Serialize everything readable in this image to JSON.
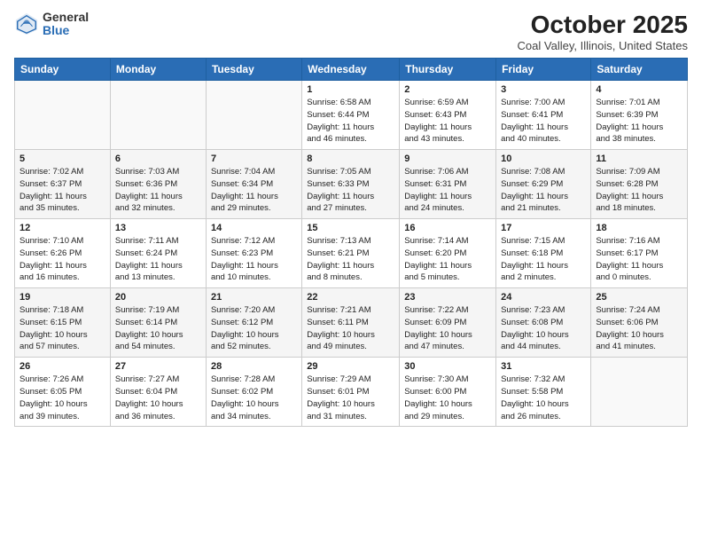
{
  "logo": {
    "general": "General",
    "blue": "Blue"
  },
  "title": "October 2025",
  "subtitle": "Coal Valley, Illinois, United States",
  "headers": [
    "Sunday",
    "Monday",
    "Tuesday",
    "Wednesday",
    "Thursday",
    "Friday",
    "Saturday"
  ],
  "weeks": [
    [
      {
        "day": "",
        "info": ""
      },
      {
        "day": "",
        "info": ""
      },
      {
        "day": "",
        "info": ""
      },
      {
        "day": "1",
        "info": "Sunrise: 6:58 AM\nSunset: 6:44 PM\nDaylight: 11 hours\nand 46 minutes."
      },
      {
        "day": "2",
        "info": "Sunrise: 6:59 AM\nSunset: 6:43 PM\nDaylight: 11 hours\nand 43 minutes."
      },
      {
        "day": "3",
        "info": "Sunrise: 7:00 AM\nSunset: 6:41 PM\nDaylight: 11 hours\nand 40 minutes."
      },
      {
        "day": "4",
        "info": "Sunrise: 7:01 AM\nSunset: 6:39 PM\nDaylight: 11 hours\nand 38 minutes."
      }
    ],
    [
      {
        "day": "5",
        "info": "Sunrise: 7:02 AM\nSunset: 6:37 PM\nDaylight: 11 hours\nand 35 minutes."
      },
      {
        "day": "6",
        "info": "Sunrise: 7:03 AM\nSunset: 6:36 PM\nDaylight: 11 hours\nand 32 minutes."
      },
      {
        "day": "7",
        "info": "Sunrise: 7:04 AM\nSunset: 6:34 PM\nDaylight: 11 hours\nand 29 minutes."
      },
      {
        "day": "8",
        "info": "Sunrise: 7:05 AM\nSunset: 6:33 PM\nDaylight: 11 hours\nand 27 minutes."
      },
      {
        "day": "9",
        "info": "Sunrise: 7:06 AM\nSunset: 6:31 PM\nDaylight: 11 hours\nand 24 minutes."
      },
      {
        "day": "10",
        "info": "Sunrise: 7:08 AM\nSunset: 6:29 PM\nDaylight: 11 hours\nand 21 minutes."
      },
      {
        "day": "11",
        "info": "Sunrise: 7:09 AM\nSunset: 6:28 PM\nDaylight: 11 hours\nand 18 minutes."
      }
    ],
    [
      {
        "day": "12",
        "info": "Sunrise: 7:10 AM\nSunset: 6:26 PM\nDaylight: 11 hours\nand 16 minutes."
      },
      {
        "day": "13",
        "info": "Sunrise: 7:11 AM\nSunset: 6:24 PM\nDaylight: 11 hours\nand 13 minutes."
      },
      {
        "day": "14",
        "info": "Sunrise: 7:12 AM\nSunset: 6:23 PM\nDaylight: 11 hours\nand 10 minutes."
      },
      {
        "day": "15",
        "info": "Sunrise: 7:13 AM\nSunset: 6:21 PM\nDaylight: 11 hours\nand 8 minutes."
      },
      {
        "day": "16",
        "info": "Sunrise: 7:14 AM\nSunset: 6:20 PM\nDaylight: 11 hours\nand 5 minutes."
      },
      {
        "day": "17",
        "info": "Sunrise: 7:15 AM\nSunset: 6:18 PM\nDaylight: 11 hours\nand 2 minutes."
      },
      {
        "day": "18",
        "info": "Sunrise: 7:16 AM\nSunset: 6:17 PM\nDaylight: 11 hours\nand 0 minutes."
      }
    ],
    [
      {
        "day": "19",
        "info": "Sunrise: 7:18 AM\nSunset: 6:15 PM\nDaylight: 10 hours\nand 57 minutes."
      },
      {
        "day": "20",
        "info": "Sunrise: 7:19 AM\nSunset: 6:14 PM\nDaylight: 10 hours\nand 54 minutes."
      },
      {
        "day": "21",
        "info": "Sunrise: 7:20 AM\nSunset: 6:12 PM\nDaylight: 10 hours\nand 52 minutes."
      },
      {
        "day": "22",
        "info": "Sunrise: 7:21 AM\nSunset: 6:11 PM\nDaylight: 10 hours\nand 49 minutes."
      },
      {
        "day": "23",
        "info": "Sunrise: 7:22 AM\nSunset: 6:09 PM\nDaylight: 10 hours\nand 47 minutes."
      },
      {
        "day": "24",
        "info": "Sunrise: 7:23 AM\nSunset: 6:08 PM\nDaylight: 10 hours\nand 44 minutes."
      },
      {
        "day": "25",
        "info": "Sunrise: 7:24 AM\nSunset: 6:06 PM\nDaylight: 10 hours\nand 41 minutes."
      }
    ],
    [
      {
        "day": "26",
        "info": "Sunrise: 7:26 AM\nSunset: 6:05 PM\nDaylight: 10 hours\nand 39 minutes."
      },
      {
        "day": "27",
        "info": "Sunrise: 7:27 AM\nSunset: 6:04 PM\nDaylight: 10 hours\nand 36 minutes."
      },
      {
        "day": "28",
        "info": "Sunrise: 7:28 AM\nSunset: 6:02 PM\nDaylight: 10 hours\nand 34 minutes."
      },
      {
        "day": "29",
        "info": "Sunrise: 7:29 AM\nSunset: 6:01 PM\nDaylight: 10 hours\nand 31 minutes."
      },
      {
        "day": "30",
        "info": "Sunrise: 7:30 AM\nSunset: 6:00 PM\nDaylight: 10 hours\nand 29 minutes."
      },
      {
        "day": "31",
        "info": "Sunrise: 7:32 AM\nSunset: 5:58 PM\nDaylight: 10 hours\nand 26 minutes."
      },
      {
        "day": "",
        "info": ""
      }
    ]
  ]
}
